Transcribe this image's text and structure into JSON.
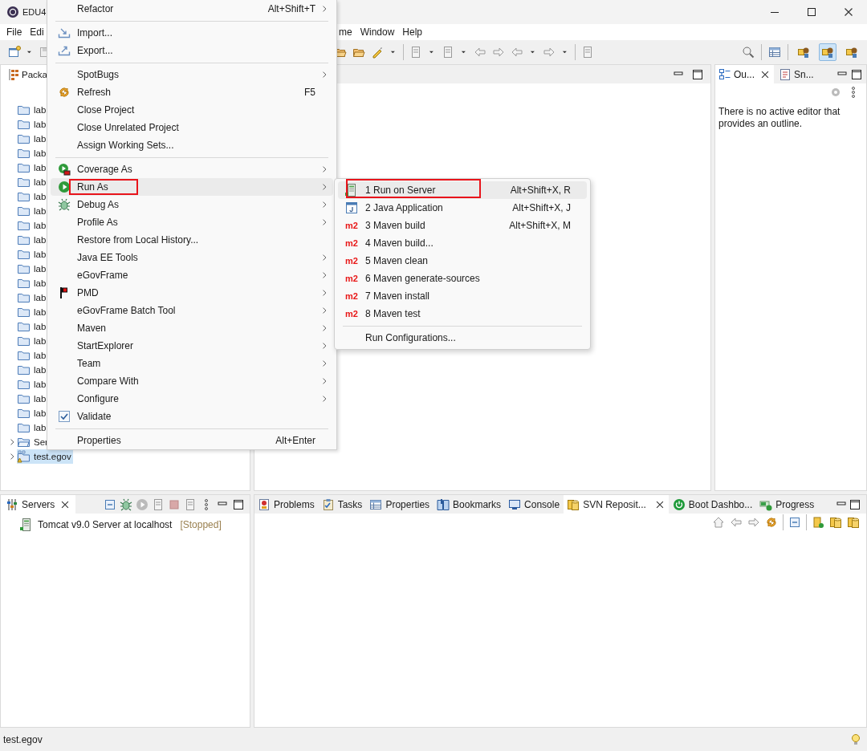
{
  "window": {
    "title": "EDU4"
  },
  "menu_bar": {
    "before_popup": [
      {
        "label": "File"
      },
      {
        "label": "Edi"
      }
    ],
    "after_popup": [
      {
        "label": "me"
      },
      {
        "label": "Window"
      },
      {
        "label": "Help"
      }
    ]
  },
  "perspective_buttons": [
    {
      "selected": false
    },
    {
      "selected": true
    },
    {
      "selected": false
    }
  ],
  "package_explorer": {
    "tab": "Packa",
    "tree": [
      {
        "label": "lab",
        "kind": "folder",
        "selected": false
      },
      {
        "label": "lab",
        "kind": "folder",
        "selected": false
      },
      {
        "label": "lab",
        "kind": "folder",
        "selected": false
      },
      {
        "label": "lab",
        "kind": "folder",
        "selected": false
      },
      {
        "label": "lab",
        "kind": "folder",
        "selected": false
      },
      {
        "label": "lab",
        "kind": "folder",
        "selected": false
      },
      {
        "label": "lab",
        "kind": "folder",
        "selected": false
      },
      {
        "label": "lab",
        "kind": "folder",
        "selected": false
      },
      {
        "label": "lab",
        "kind": "folder",
        "selected": false
      },
      {
        "label": "lab",
        "kind": "folder",
        "selected": false
      },
      {
        "label": "lab",
        "kind": "folder",
        "selected": false
      },
      {
        "label": "lab",
        "kind": "folder",
        "selected": false
      },
      {
        "label": "lab",
        "kind": "folder",
        "selected": false
      },
      {
        "label": "lab",
        "kind": "folder",
        "selected": false
      },
      {
        "label": "lab",
        "kind": "folder",
        "selected": false
      },
      {
        "label": "lab",
        "kind": "folder",
        "selected": false
      },
      {
        "label": "lab",
        "kind": "folder",
        "selected": false
      },
      {
        "label": "lab",
        "kind": "folder",
        "selected": false
      },
      {
        "label": "lab",
        "kind": "folder",
        "selected": false
      },
      {
        "label": "lab",
        "kind": "folder",
        "selected": false
      },
      {
        "label": "lab",
        "kind": "folder",
        "selected": false
      },
      {
        "label": "lab",
        "kind": "folder",
        "selected": false
      },
      {
        "label": "lab",
        "kind": "folder",
        "selected": false
      },
      {
        "label": "Ser",
        "kind": "working-set",
        "selected": false
      },
      {
        "label": "test.egov",
        "kind": "project",
        "selected": true
      }
    ]
  },
  "context_menu": [
    {
      "kind": "item",
      "label": "Refactor",
      "shortcut": "Alt+Shift+T",
      "submenu": true,
      "selected": false,
      "annotated": false
    },
    {
      "kind": "separator"
    },
    {
      "kind": "item",
      "label": "Import...",
      "submenu": false,
      "selected": false,
      "annotated": false
    },
    {
      "kind": "item",
      "label": "Export...",
      "submenu": false,
      "selected": false,
      "annotated": false
    },
    {
      "kind": "separator"
    },
    {
      "kind": "item",
      "label": "SpotBugs",
      "submenu": true,
      "selected": false,
      "annotated": false
    },
    {
      "kind": "item",
      "label": "Refresh",
      "shortcut": "F5",
      "submenu": false,
      "selected": false,
      "annotated": false
    },
    {
      "kind": "item",
      "label": "Close Project",
      "submenu": false,
      "selected": false,
      "annotated": false
    },
    {
      "kind": "item",
      "label": "Close Unrelated Project",
      "submenu": false,
      "selected": false,
      "annotated": false
    },
    {
      "kind": "item",
      "label": "Assign Working Sets...",
      "submenu": false,
      "selected": false,
      "annotated": false
    },
    {
      "kind": "separator"
    },
    {
      "kind": "item",
      "label": "Coverage As",
      "submenu": true,
      "selected": false,
      "annotated": false
    },
    {
      "kind": "item",
      "label": "Run As",
      "submenu": true,
      "selected": true,
      "annotated": true
    },
    {
      "kind": "item",
      "label": "Debug As",
      "submenu": true,
      "selected": false,
      "annotated": false
    },
    {
      "kind": "item",
      "label": "Profile As",
      "submenu": true,
      "selected": false,
      "annotated": false
    },
    {
      "kind": "item",
      "label": "Restore from Local History...",
      "submenu": false,
      "selected": false,
      "annotated": false
    },
    {
      "kind": "item",
      "label": "Java EE Tools",
      "submenu": true,
      "selected": false,
      "annotated": false
    },
    {
      "kind": "item",
      "label": "eGovFrame",
      "submenu": true,
      "selected": false,
      "annotated": false
    },
    {
      "kind": "item",
      "label": "PMD",
      "submenu": true,
      "selected": false,
      "annotated": false
    },
    {
      "kind": "item",
      "label": "eGovFrame Batch Tool",
      "submenu": true,
      "selected": false,
      "annotated": false
    },
    {
      "kind": "item",
      "label": "Maven",
      "submenu": true,
      "selected": false,
      "annotated": false
    },
    {
      "kind": "item",
      "label": "StartExplorer",
      "submenu": true,
      "selected": false,
      "annotated": false
    },
    {
      "kind": "item",
      "label": "Team",
      "submenu": true,
      "selected": false,
      "annotated": false
    },
    {
      "kind": "item",
      "label": "Compare With",
      "submenu": true,
      "selected": false,
      "annotated": false
    },
    {
      "kind": "item",
      "label": "Configure",
      "submenu": true,
      "selected": false,
      "annotated": false
    },
    {
      "kind": "item",
      "label": "Validate",
      "submenu": false,
      "selected": false,
      "annotated": false
    },
    {
      "kind": "separator"
    },
    {
      "kind": "item",
      "label": "Properties",
      "shortcut": "Alt+Enter",
      "submenu": false,
      "selected": false,
      "annotated": false
    }
  ],
  "run_as_submenu": [
    {
      "kind": "item",
      "label": "1 Run on Server",
      "shortcut": "Alt+Shift+X, R",
      "selected": true,
      "annotated": true
    },
    {
      "kind": "item",
      "label": "2 Java Application",
      "shortcut": "Alt+Shift+X, J",
      "selected": false,
      "annotated": false
    },
    {
      "kind": "item",
      "label": "3 Maven build",
      "shortcut": "Alt+Shift+X, M",
      "badge": "m2",
      "selected": false,
      "annotated": false
    },
    {
      "kind": "item",
      "label": "4 Maven build...",
      "badge": "m2",
      "selected": false,
      "annotated": false
    },
    {
      "kind": "item",
      "label": "5 Maven clean",
      "badge": "m2",
      "selected": false,
      "annotated": false
    },
    {
      "kind": "item",
      "label": "6 Maven generate-sources",
      "badge": "m2",
      "selected": false,
      "annotated": false
    },
    {
      "kind": "item",
      "label": "7 Maven install",
      "badge": "m2",
      "selected": false,
      "annotated": false
    },
    {
      "kind": "item",
      "label": "8 Maven test",
      "badge": "m2",
      "selected": false,
      "annotated": false
    },
    {
      "kind": "separator"
    },
    {
      "kind": "item",
      "label": "Run Configurations...",
      "selected": false,
      "annotated": false
    }
  ],
  "outline_panel": {
    "tabs": [
      {
        "label": "Ou...",
        "kind": "outline",
        "selected": true
      },
      {
        "label": "Sn...",
        "kind": "snippets",
        "selected": false
      }
    ],
    "message": "There is no active editor that provides an outline."
  },
  "servers_panel": {
    "tab": "Servers",
    "servers": [
      {
        "name": "Tomcat v9.0 Server at localhost",
        "status": "[Stopped]"
      }
    ]
  },
  "bottom_tabs": [
    {
      "label": "Problems",
      "kind": "problems",
      "selected": false
    },
    {
      "label": "Tasks",
      "kind": "tasks",
      "selected": false
    },
    {
      "label": "Properties",
      "kind": "properties",
      "selected": false
    },
    {
      "label": "Bookmarks",
      "kind": "bookmarks",
      "selected": false
    },
    {
      "label": "Console",
      "kind": "console",
      "selected": false
    },
    {
      "label": "SVN Reposit...",
      "kind": "svn",
      "selected": true
    },
    {
      "label": "Boot Dashbo...",
      "kind": "boot",
      "selected": false
    },
    {
      "label": "Progress",
      "kind": "progress",
      "selected": false
    }
  ],
  "status_bar": {
    "text": "test.egov"
  }
}
